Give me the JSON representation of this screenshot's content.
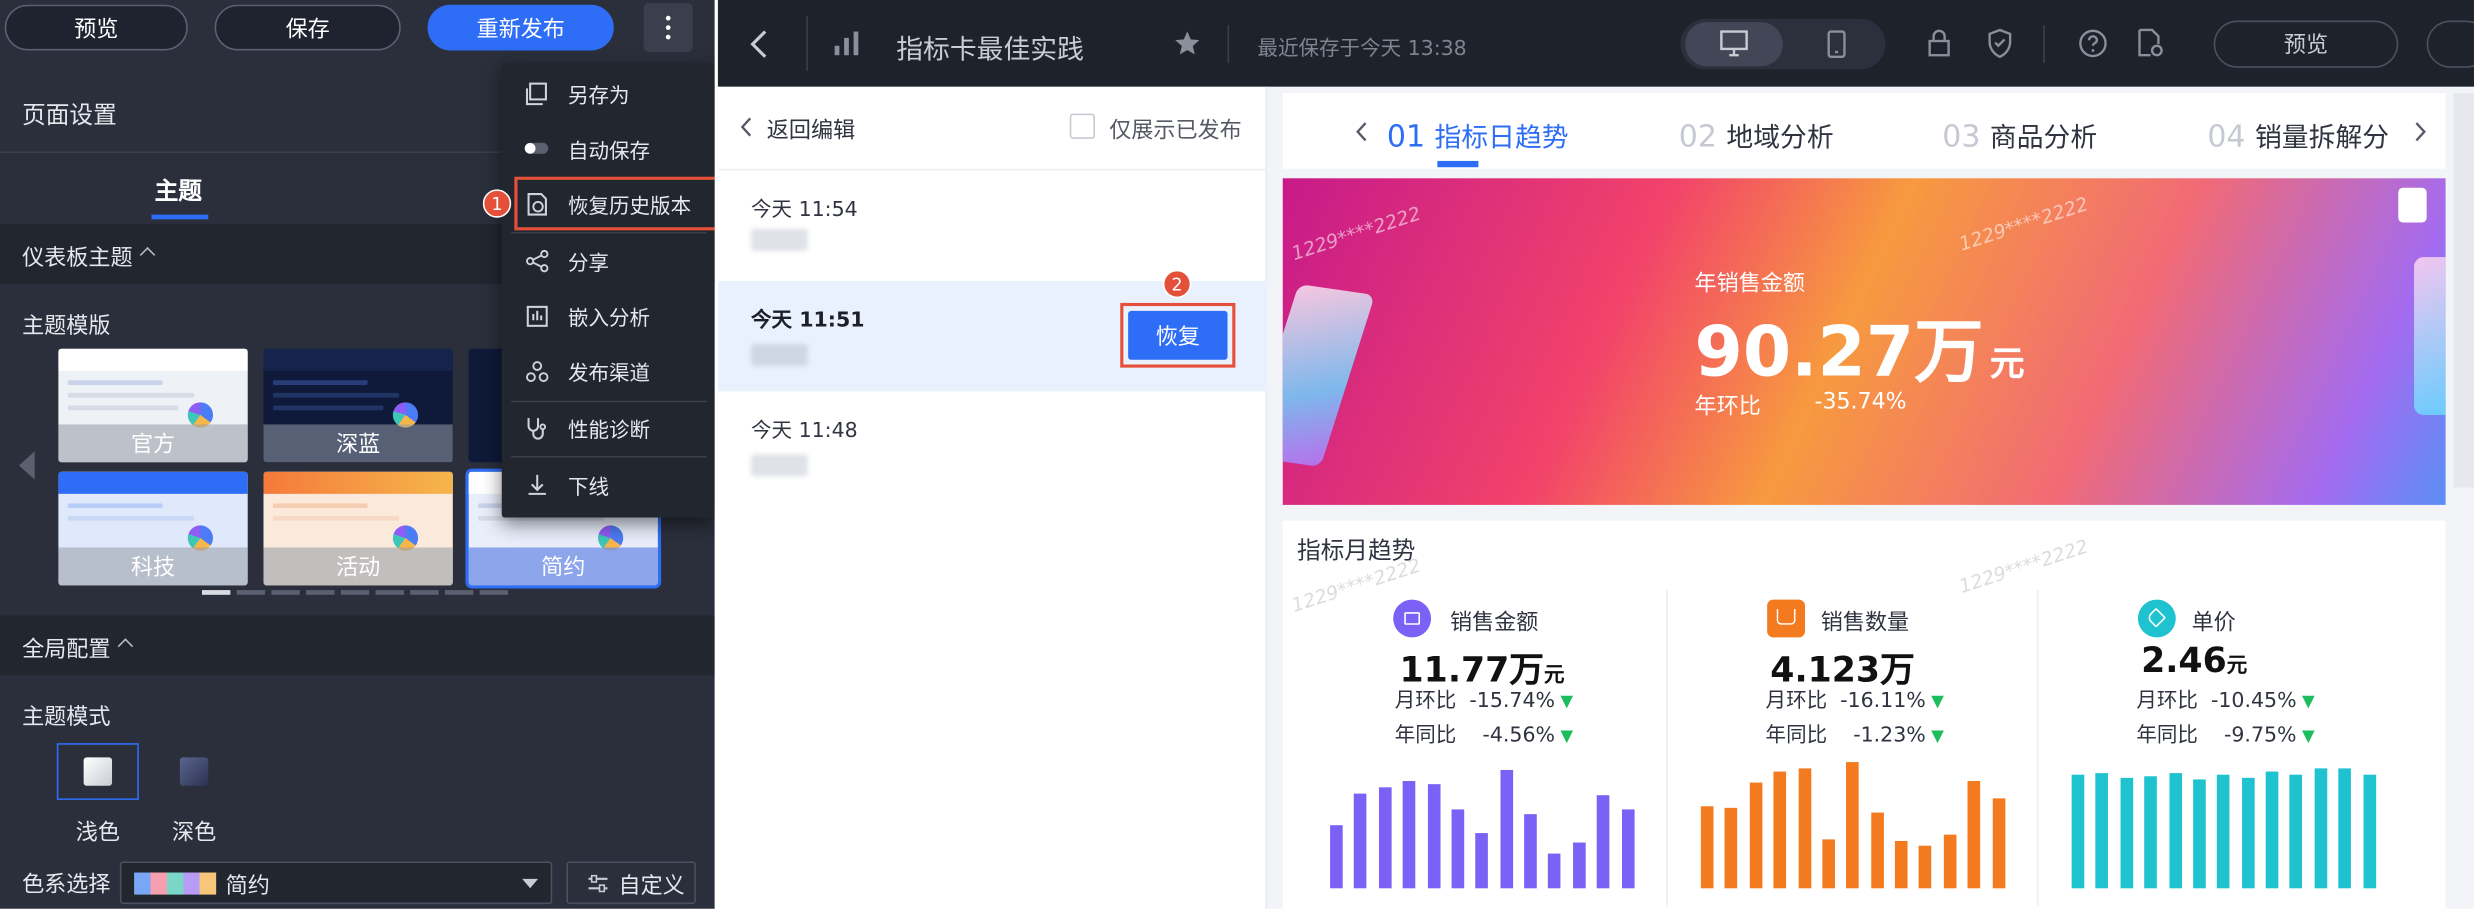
{
  "left_panel": {
    "buttons": {
      "preview": "预览",
      "save": "保存",
      "republish": "重新发布"
    },
    "page_settings": "页面设置",
    "theme_tab": "主题",
    "dashboard_theme": "仪表板主题",
    "theme_template": "主题模版",
    "templates": [
      "官方",
      "深蓝",
      "科技",
      "活动",
      "简约"
    ],
    "global_config": "全局配置",
    "theme_mode": "主题模式",
    "modes": {
      "light": "浅色",
      "dark": "深色"
    },
    "color_scheme_label": "色系选择",
    "color_scheme_value": "简约",
    "customize": "自定义"
  },
  "menu": {
    "items": [
      "另存为",
      "自动保存",
      "恢复历史版本",
      "分享",
      "嵌入分析",
      "发布渠道",
      "性能诊断",
      "下线"
    ],
    "badge1": "1"
  },
  "topbar": {
    "title": "指标卡最佳实践",
    "saved_status": "最近保存于今天 13:38",
    "preview": "预览"
  },
  "history": {
    "back": "返回编辑",
    "only_published": "仅展示已发布",
    "items": [
      {
        "time": "今天 11:54"
      },
      {
        "time": "今天 11:51"
      },
      {
        "time": "今天 11:48"
      }
    ],
    "restore": "恢复",
    "badge2": "2"
  },
  "dashboard": {
    "tabs": [
      {
        "num": "01",
        "label": "指标日趋势"
      },
      {
        "num": "02",
        "label": "地域分析"
      },
      {
        "num": "03",
        "label": "商品分析"
      },
      {
        "num": "04",
        "label": "销量拆解分"
      }
    ],
    "banner": {
      "label": "年销售金额",
      "value": "90.27万",
      "unit": "元",
      "yoy_label": "年环比",
      "yoy_value": "-35.74%",
      "watermark": "1229****2222"
    },
    "monthly_title": "指标月趋势",
    "kpis": [
      {
        "name": "销售金额",
        "value": "11.77万",
        "unit": "元",
        "mom_label": "月环比",
        "mom": "-15.74%",
        "yoy_label": "年同比",
        "yoy": "-4.56%",
        "color": "#7b61f5",
        "bars": [
          40,
          60,
          64,
          68,
          66,
          50,
          35,
          75,
          47,
          22,
          29,
          59,
          50
        ]
      },
      {
        "name": "销售数量",
        "value": "4.123万",
        "unit": "",
        "mom_label": "月环比",
        "mom": "-16.11%",
        "yoy_label": "年同比",
        "yoy": "-1.23%",
        "color": "#f47a1f",
        "bars": [
          52,
          51,
          67,
          74,
          76,
          31,
          80,
          48,
          30,
          27,
          34,
          68,
          57
        ]
      },
      {
        "name": "单价",
        "value": "2.46",
        "unit": "元",
        "mom_label": "月环比",
        "mom": "-10.45%",
        "yoy_label": "年同比",
        "yoy": "-9.75%",
        "color": "#1fc3d0",
        "bars": [
          72,
          73,
          70,
          71,
          73,
          69,
          72,
          70,
          74,
          72,
          76,
          76,
          72
        ]
      }
    ]
  },
  "colors": {
    "accent": "#2e6df6",
    "highlight": "#e4503a",
    "dark_panel": "#2b2f3b"
  },
  "icons": [
    "save-as-icon",
    "toggle-icon",
    "history-icon",
    "share-icon",
    "embed-icon",
    "channel-icon",
    "diagnose-icon",
    "offline-icon",
    "back-icon",
    "bar-chart-icon",
    "star-icon",
    "desktop-icon",
    "mobile-icon",
    "lock-icon",
    "shield-icon",
    "help-icon",
    "file-settings-icon"
  ]
}
